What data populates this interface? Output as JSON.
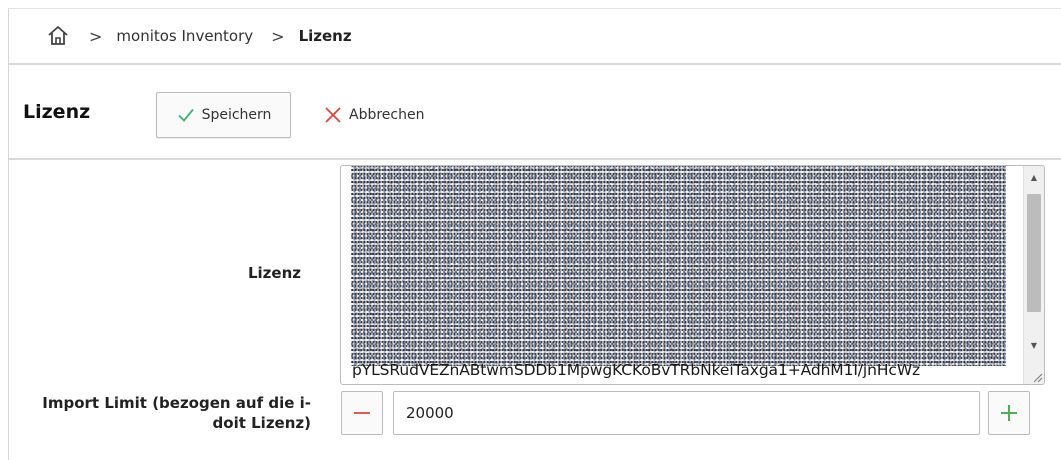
{
  "breadcrumb": {
    "home_icon": "home-icon",
    "separator": ">",
    "items": [
      {
        "label": "monitos Inventory"
      },
      {
        "label": "Lizenz"
      }
    ]
  },
  "toolbar": {
    "title": "Lizenz",
    "save_label": "Speichern",
    "cancel_label": "Abbrechen",
    "save_icon": "checkmark-icon",
    "cancel_icon": "close-icon"
  },
  "form": {
    "lizenz_label": "Lizenz",
    "lizenz_visible_line": "pYLSRudVEZnABtwmSDDb1MpwgKCKoBvTRbNkeiTaxga1+AdhM1I/jnHcWz",
    "import_limit_label_line1": "Import Limit (bezogen auf die i-",
    "import_limit_label_line2": "doit Lizenz)",
    "import_limit_value": "20000",
    "minus_icon": "minus-icon",
    "plus_icon": "plus-icon"
  },
  "colors": {
    "save_check": "#3cb371",
    "cancel_x": "#e0443a",
    "minus": "#e05a5a",
    "plus": "#4caf50",
    "divider": "#d9d9d9"
  }
}
